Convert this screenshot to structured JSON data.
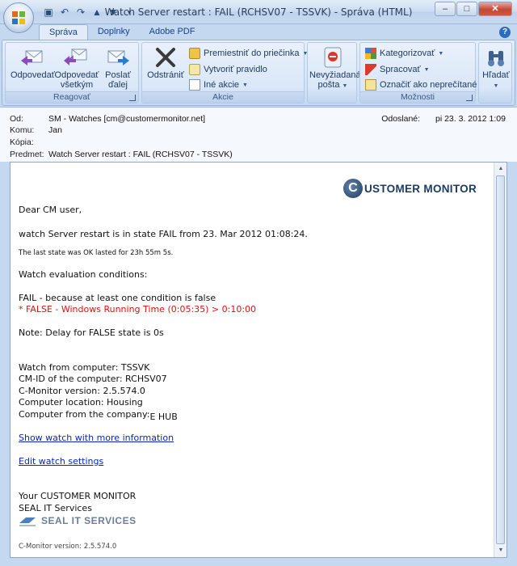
{
  "window": {
    "title": "Watch Server restart : FAIL (RCHSV07 - TSSVK) - Správa (HTML)",
    "minimize": "–",
    "maximize": "□",
    "close": "✕"
  },
  "ribbon": {
    "tabs": [
      "Správa",
      "Doplnky",
      "Adobe PDF"
    ],
    "help": "?",
    "groups": {
      "reagovat": {
        "label": "Reagovať",
        "reply": "Odpovedať",
        "reply_all_1": "Odpovedať",
        "reply_all_2": "všetkým",
        "forward_1": "Poslať",
        "forward_2": "ďalej"
      },
      "akcie": {
        "label": "Akcie",
        "delete": "Odstrániť",
        "move": "Premiestniť do priečinka",
        "rule": "Vytvoriť pravidlo",
        "other": "Iné akcie"
      },
      "junk": {
        "label_1": "Nevyžiadaná",
        "label_2": "pošta"
      },
      "moznosti": {
        "label": "Možnosti",
        "categorize": "Kategorizovať",
        "followup": "Spracovať",
        "unread": "Označiť ako neprečítané"
      },
      "find": {
        "label": "Hľadať"
      }
    }
  },
  "header": {
    "from_label": "Od:",
    "from": "SM - Watches [cm@customermonitor.net]",
    "to_label": "Komu:",
    "to": "Jan",
    "cc_label": "Kópia:",
    "cc": "",
    "subject_label": "Predmet:",
    "subject": "Watch Server restart : FAIL (RCHSV07 - TSSVK)",
    "sent_label": "Odoslané:",
    "sent": "pi 23. 3. 2012 1:09"
  },
  "body": {
    "logo_letter": "C",
    "logo_text": "USTOMER MONITOR",
    "greeting": "Dear CM user,",
    "state_line": "watch Server restart is in state FAIL from 23. Mar 2012 01:08:24.",
    "last_state": "The last state was OK lasted for 23h 55m 5s.",
    "conditions_title": "Watch evaluation conditions:",
    "fail_reason": "FAIL - because at least one condition is false",
    "false_condition": "* FALSE - Windows Running Time (0:05:35) > 0:10:00",
    "note": "Note: Delay for FALSE state is 0s",
    "computer": "Watch from computer: TSSVK",
    "cmid": "CM-ID of the computer: RCHSV07",
    "version": "C-Monitor version: 2.5.574.0",
    "location": "Computer location: Housing",
    "company_label": "Computer from the company:",
    "company": "E HUB",
    "link_more": "Show watch with more information",
    "link_edit": "Edit watch settings",
    "sign_1": "Your CUSTOMER MONITOR",
    "sign_2": "SEAL IT Services",
    "seal_logo": "SEAL IT SERVICES",
    "footer": "C-Monitor version: 2.5.574.0"
  },
  "colors": {
    "accent": "#15428b",
    "link": "#0a24c8",
    "error": "#e01010"
  }
}
